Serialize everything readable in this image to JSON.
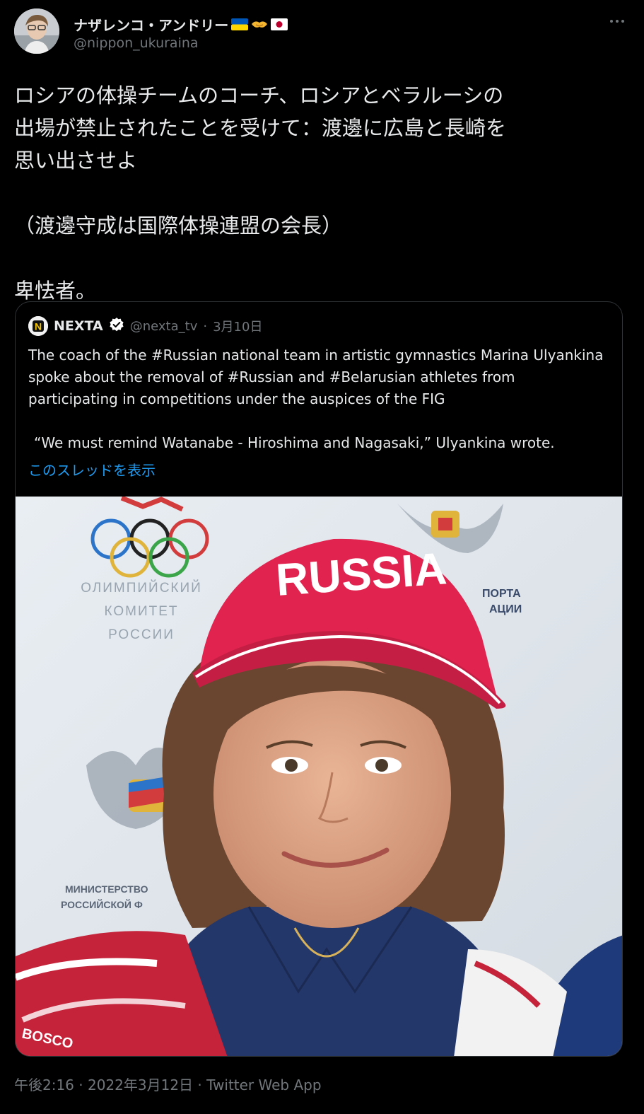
{
  "author": {
    "display_name": "ナザレンコ・アンドリー",
    "handle": "@nippon_ukuraina"
  },
  "tweet": {
    "lines": [
      "ロシアの体操チームのコーチ、ロシアとベラルーシの",
      "出場が禁止されたことを受けて：渡邊に広島と長崎を",
      "思い出させよ",
      "（渡邊守成は国際体操連盟の会長）",
      "卑怯者。"
    ]
  },
  "quoted_tweet": {
    "name": "NEXTA",
    "avatar_letter": "N",
    "handle": "@nexta_tv",
    "separator": "·",
    "date": "3月10日",
    "body": [
      "The coach of the #Russian national team in artistic gymnastics Marina Ulyankina",
      "spoke about the removal of #Russian and #Belarusian athletes from",
      "participating in competitions under the auspices of the FIG",
      "“We must remind Watanabe - Hiroshima and Nagasaki,” Ulyankina wrote."
    ],
    "show_thread": "このスレッドを表示",
    "image_text": {
      "cap": "RUSSIA",
      "backdrop_left": [
        "ОЛИМПИЙСКИЙ",
        "КОМИТЕТ",
        "РОССИИ"
      ],
      "backdrop_right": [
        "ПОРТА",
        "АЦИИ"
      ],
      "backdrop_bottom": [
        "МИНИСТЕРСТВО",
        "РОССИЙСКОЙ Ф"
      ],
      "jacket": "BOSCO"
    }
  },
  "footer": {
    "timestamp": "午後2:16 · 2022年3月12日 · Twitter Web App"
  },
  "colors": {
    "background": "#000000",
    "text": "#e7e9ea",
    "muted": "#71767b",
    "link": "#1d9bf0",
    "border": "#2f3336",
    "verified": "#ffffff"
  }
}
